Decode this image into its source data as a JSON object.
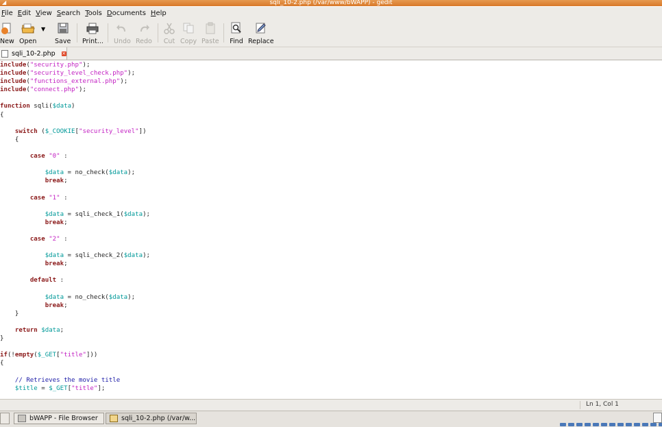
{
  "window": {
    "title": "sqli_10-2.php (/var/www/bWAPP) - gedit"
  },
  "menu": [
    "File",
    "Edit",
    "View",
    "Search",
    "Tools",
    "Documents",
    "Help"
  ],
  "toolbar": {
    "new": "New",
    "open": "Open",
    "save": "Save",
    "print": "Print...",
    "undo": "Undo",
    "redo": "Redo",
    "cut": "Cut",
    "copy": "Copy",
    "paste": "Paste",
    "find": "Find",
    "replace": "Replace"
  },
  "tab": {
    "label": "sqli_10-2.php"
  },
  "code": [
    "include(\"security.php\");",
    "include(\"security_level_check.php\");",
    "include(\"functions_external.php\");",
    "include(\"connect.php\");",
    "",
    "function sqli($data)",
    "{",
    "",
    "    switch ($_COOKIE[\"security_level\"])",
    "    {",
    "",
    "        case \"0\" :",
    "",
    "            $data = no_check($data);",
    "            break;",
    "",
    "        case \"1\" :",
    "",
    "            $data = sqli_check_1($data);",
    "            break;",
    "",
    "        case \"2\" :",
    "",
    "            $data = sqli_check_2($data);",
    "            break;",
    "",
    "        default :",
    "",
    "            $data = no_check($data);",
    "            break;",
    "    }",
    "",
    "    return $data;",
    "}",
    "",
    "if(!empty($_GET[\"title\"]))",
    "{",
    "",
    "    // Retrieves the movie title",
    "    $title = $_GET[\"title\"];"
  ],
  "status": {
    "position": "Ln 1, Col 1"
  },
  "taskbar": {
    "items": [
      "bWAPP - File Browser",
      "sqli_10-2.php (/var/w..."
    ]
  },
  "colors": {
    "keyword": "#8b1a1a",
    "string": "#c21fc2",
    "variable": "#009999",
    "comment": "#1a1aa6"
  }
}
